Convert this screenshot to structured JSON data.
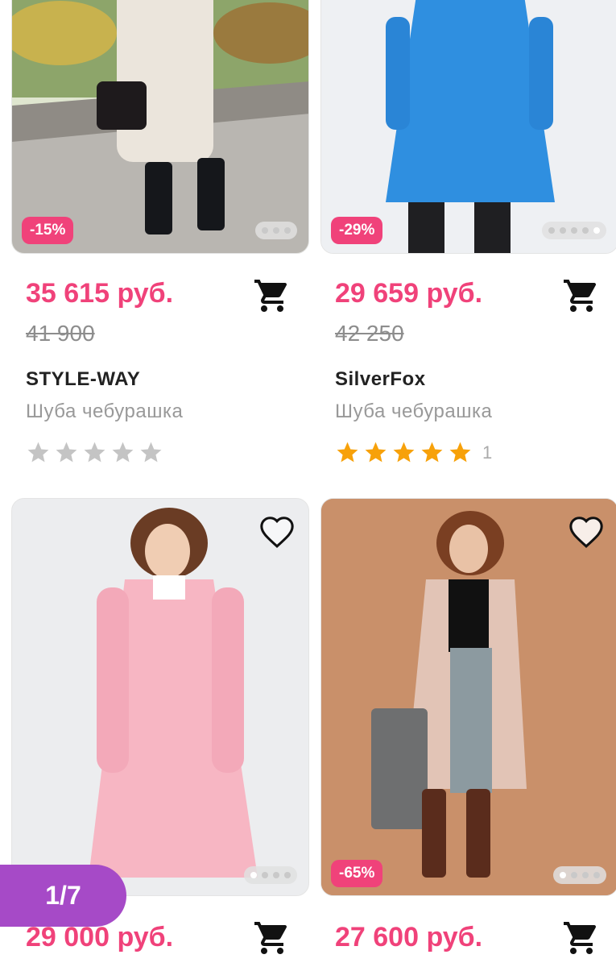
{
  "products": [
    {
      "discount": "-15%",
      "price": "35 615 руб.",
      "old_price": "41 900",
      "brand": "STYLE-WAY",
      "title": "Шуба чебурашка",
      "rating_filled": 0,
      "review_count": "",
      "color": "#e9e2d8",
      "image_dots": 3,
      "active_dot": -1
    },
    {
      "discount": "-29%",
      "price": "29 659 руб.",
      "old_price": "42 250",
      "brand": "SilverFox",
      "title": "Шуба чебурашка",
      "rating_filled": 5,
      "review_count": "1",
      "color": "#2f8fe0",
      "image_dots": 5,
      "active_dot": 4
    },
    {
      "discount": "",
      "price": "29 000 руб.",
      "color": "#f7b6c3",
      "image_dots": 4,
      "active_dot": 0
    },
    {
      "discount": "-65%",
      "price": "27 600 руб.",
      "color": "#c9906a",
      "image_dots": 4,
      "active_dot": 0
    }
  ],
  "pager": {
    "text": "1/7"
  },
  "colors": {
    "accent_pink": "#f0427a",
    "star_filled": "#f7a10a",
    "star_empty": "#c4c4c4",
    "pager_purple": "#a64ac7"
  }
}
